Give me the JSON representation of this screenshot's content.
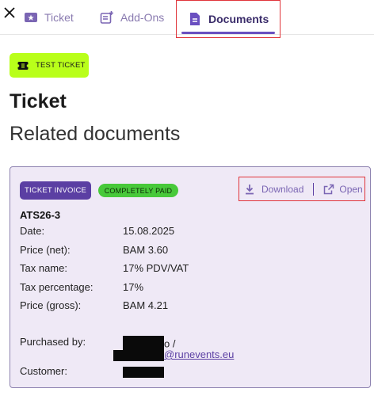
{
  "nav": {
    "tabs": [
      {
        "label": "Ticket",
        "icon": "ticket-icon"
      },
      {
        "label": "Add-Ons",
        "icon": "add-ons-icon"
      },
      {
        "label": "Documents",
        "icon": "document-icon"
      }
    ]
  },
  "ticket": {
    "test_badge": "TEST TICKET",
    "heading": "Ticket",
    "related_heading": "Related documents"
  },
  "document": {
    "type_badge": "TICKET INVOICE",
    "status_badge": "COMPLETELY PAID",
    "actions": {
      "download": "Download",
      "open": "Open"
    },
    "number": "ATS26-3",
    "fields": {
      "date": {
        "label": "Date:",
        "value": "15.08.2025"
      },
      "price_net": {
        "label": "Price (net):",
        "value": "BAM 3.60"
      },
      "tax_name": {
        "label": "Tax name:",
        "value": "17% PDV/VAT"
      },
      "tax_percentage": {
        "label": "Tax percentage:",
        "value": "17%"
      },
      "price_gross": {
        "label": "Price (gross):",
        "value": "BAM 4.21"
      },
      "purchased_by": {
        "label": "Purchased by:",
        "value_suffix_1": "o /",
        "email_suffix": "@runevents.eu"
      },
      "customer": {
        "label": "Customer:"
      }
    }
  },
  "colors": {
    "accent": "#5b3fa3",
    "test_badge": "#b9ff1a",
    "paid_badge": "#48c93a",
    "card_bg": "#efe9f6",
    "highlight_border": "#e0343a"
  }
}
